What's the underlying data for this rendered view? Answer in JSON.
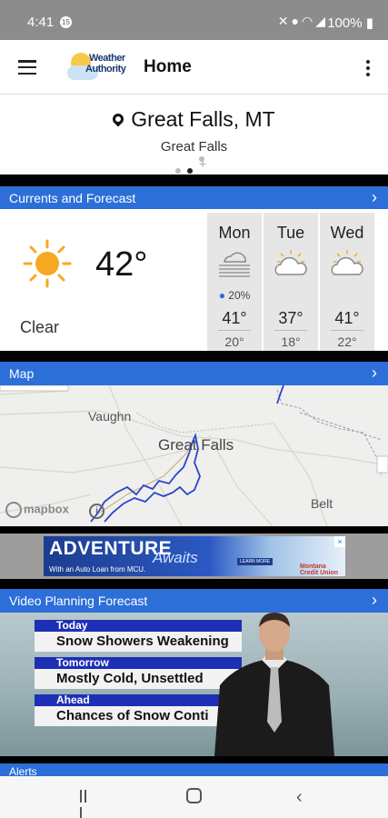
{
  "status_bar": {
    "time": "4:41",
    "notification_badge": "15",
    "icons": [
      "mute-icon",
      "location-icon",
      "wifi-icon",
      "signal-icon"
    ],
    "battery": "100%"
  },
  "app_bar": {
    "logo_line1": "Weather",
    "logo_line2": "Authority",
    "title": "Home"
  },
  "location": {
    "name": "Great Falls, MT",
    "sub": "Great Falls",
    "page_dots": 2,
    "active_dot": 1
  },
  "sections": {
    "currents": "Currents and Forecast",
    "map": "Map",
    "video": "Video Planning Forecast",
    "next": "Alerts"
  },
  "current": {
    "temp": "42°",
    "condition": "Clear",
    "icon": "sun-icon"
  },
  "days": [
    {
      "name": "Mon",
      "icon": "fog-icon",
      "precip": "20%",
      "hi": "41°",
      "lo": "20°"
    },
    {
      "name": "Tue",
      "icon": "partly-cloudy-icon",
      "precip": "",
      "hi": "37°",
      "lo": "18°"
    },
    {
      "name": "Wed",
      "icon": "partly-cloudy-icon",
      "precip": "",
      "hi": "41°",
      "lo": "22°"
    }
  ],
  "map": {
    "labels": {
      "vaughn": "Vaughn",
      "great_falls": "Great Falls",
      "belt": "Belt"
    },
    "attribution": "mapbox",
    "info": "i"
  },
  "ad": {
    "headline": "ADVENTURE",
    "script": "Awaits",
    "tagline": "With an Auto Loan from MCU.",
    "cta": "LEARN MORE",
    "brand": "Montana Credit Union",
    "close": "×"
  },
  "video": {
    "rows": [
      {
        "heading": "Today",
        "text": "Snow Showers Weakening"
      },
      {
        "heading": "Tomorrow",
        "text": "Mostly Cold, Unsettled"
      },
      {
        "heading": "Ahead",
        "text": "Chances of Snow Conti"
      }
    ]
  },
  "colors": {
    "accent": "#2d6fd9",
    "status_bar": "#8c8c8c",
    "sun": "#f7a823",
    "river": "#2a45c8"
  }
}
